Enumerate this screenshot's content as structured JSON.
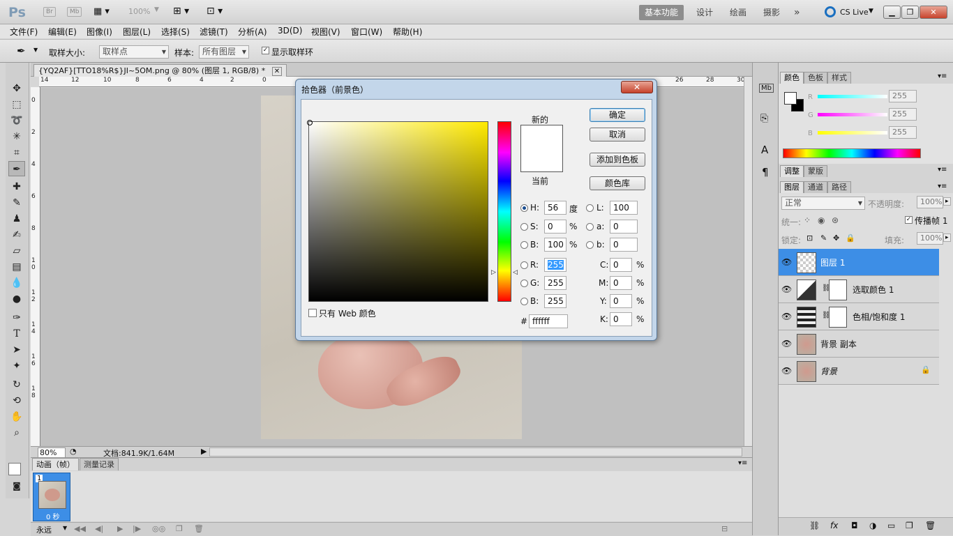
{
  "app": {
    "logo": "Ps",
    "chips": [
      "Br",
      "Mb"
    ],
    "zoom": "100%",
    "workspaces": [
      "基本功能",
      "设计",
      "绘画",
      "摄影"
    ],
    "more": "»",
    "cslive": "CS Live",
    "win_min": "▁",
    "win_max": "❐",
    "win_close": "✕"
  },
  "menu": [
    "文件(F)",
    "编辑(E)",
    "图像(I)",
    "图层(L)",
    "选择(S)",
    "滤镜(T)",
    "分析(A)",
    "3D(D)",
    "视图(V)",
    "窗口(W)",
    "帮助(H)"
  ],
  "options": {
    "sample_size_label": "取样大小:",
    "sample_size_value": "取样点",
    "sample_label": "样本:",
    "sample_value": "所有图层",
    "show_ring_label": "显示取样环"
  },
  "document": {
    "tab_title": "{YQ2AF}[TTO18%R$}JI~5OM.png @ 80% (图层 1, RGB/8) *",
    "tab_close": "✕",
    "ruler_top": [
      "14",
      "12",
      "10",
      "8",
      "6",
      "4",
      "2",
      "0",
      "26",
      "28",
      "30"
    ],
    "ruler_left": [
      "0",
      "2",
      "4",
      "6",
      "8",
      "1 0",
      "1 2",
      "1 4",
      "1 6",
      "1 8"
    ],
    "zoom": "80%",
    "doc_info": "文档:841.9K/1.64M"
  },
  "animation": {
    "tabs": [
      "动画（帧）",
      "测量记录"
    ],
    "frame_number": "1",
    "frame_delay": "0 秒",
    "loop": "永远"
  },
  "color_panel": {
    "tabs": [
      "颜色",
      "色板",
      "样式"
    ],
    "channels": [
      {
        "name": "R",
        "value": "255"
      },
      {
        "name": "G",
        "value": "255"
      },
      {
        "name": "B",
        "value": "255"
      }
    ]
  },
  "adjust_panel": {
    "tabs": [
      "调整",
      "蒙版"
    ]
  },
  "layers_panel": {
    "tabs": [
      "图层",
      "通道",
      "路径"
    ],
    "blend_mode": "正常",
    "opacity_label": "不透明度:",
    "opacity_value": "100%",
    "unify_label": "统一:",
    "propagate_label": "传播帧 1",
    "lock_label": "锁定:",
    "fill_label": "填充:",
    "fill_value": "100%",
    "layers": [
      {
        "name": "图层 1",
        "selected": true
      },
      {
        "name": "选取颜色 1",
        "selected": false
      },
      {
        "name": "色相/饱和度 1",
        "selected": false
      },
      {
        "name": "背景 副本",
        "selected": false
      },
      {
        "name": "背景",
        "selected": false
      }
    ]
  },
  "color_picker": {
    "title": "拾色器（前景色）",
    "new_label": "新的",
    "current_label": "当前",
    "ok": "确定",
    "cancel": "取消",
    "add_swatch": "添加到色板",
    "color_library": "颜色库",
    "web_only": "只有 Web 颜色",
    "fields": {
      "H": {
        "label": "H:",
        "value": "56",
        "unit": "度"
      },
      "S": {
        "label": "S:",
        "value": "0",
        "unit": "%"
      },
      "B": {
        "label": "B:",
        "value": "100",
        "unit": "%"
      },
      "R": {
        "label": "R:",
        "value": "255"
      },
      "G": {
        "label": "G:",
        "value": "255"
      },
      "Bb": {
        "label": "B:",
        "value": "255"
      },
      "L": {
        "label": "L:",
        "value": "100"
      },
      "a": {
        "label": "a:",
        "value": "0"
      },
      "b": {
        "label": "b:",
        "value": "0"
      },
      "C": {
        "label": "C:",
        "value": "0",
        "unit": "%"
      },
      "M": {
        "label": "M:",
        "value": "0",
        "unit": "%"
      },
      "Y": {
        "label": "Y:",
        "value": "0",
        "unit": "%"
      },
      "K": {
        "label": "K:",
        "value": "0",
        "unit": "%"
      }
    },
    "hex_label": "#",
    "hex": "ffffff"
  }
}
